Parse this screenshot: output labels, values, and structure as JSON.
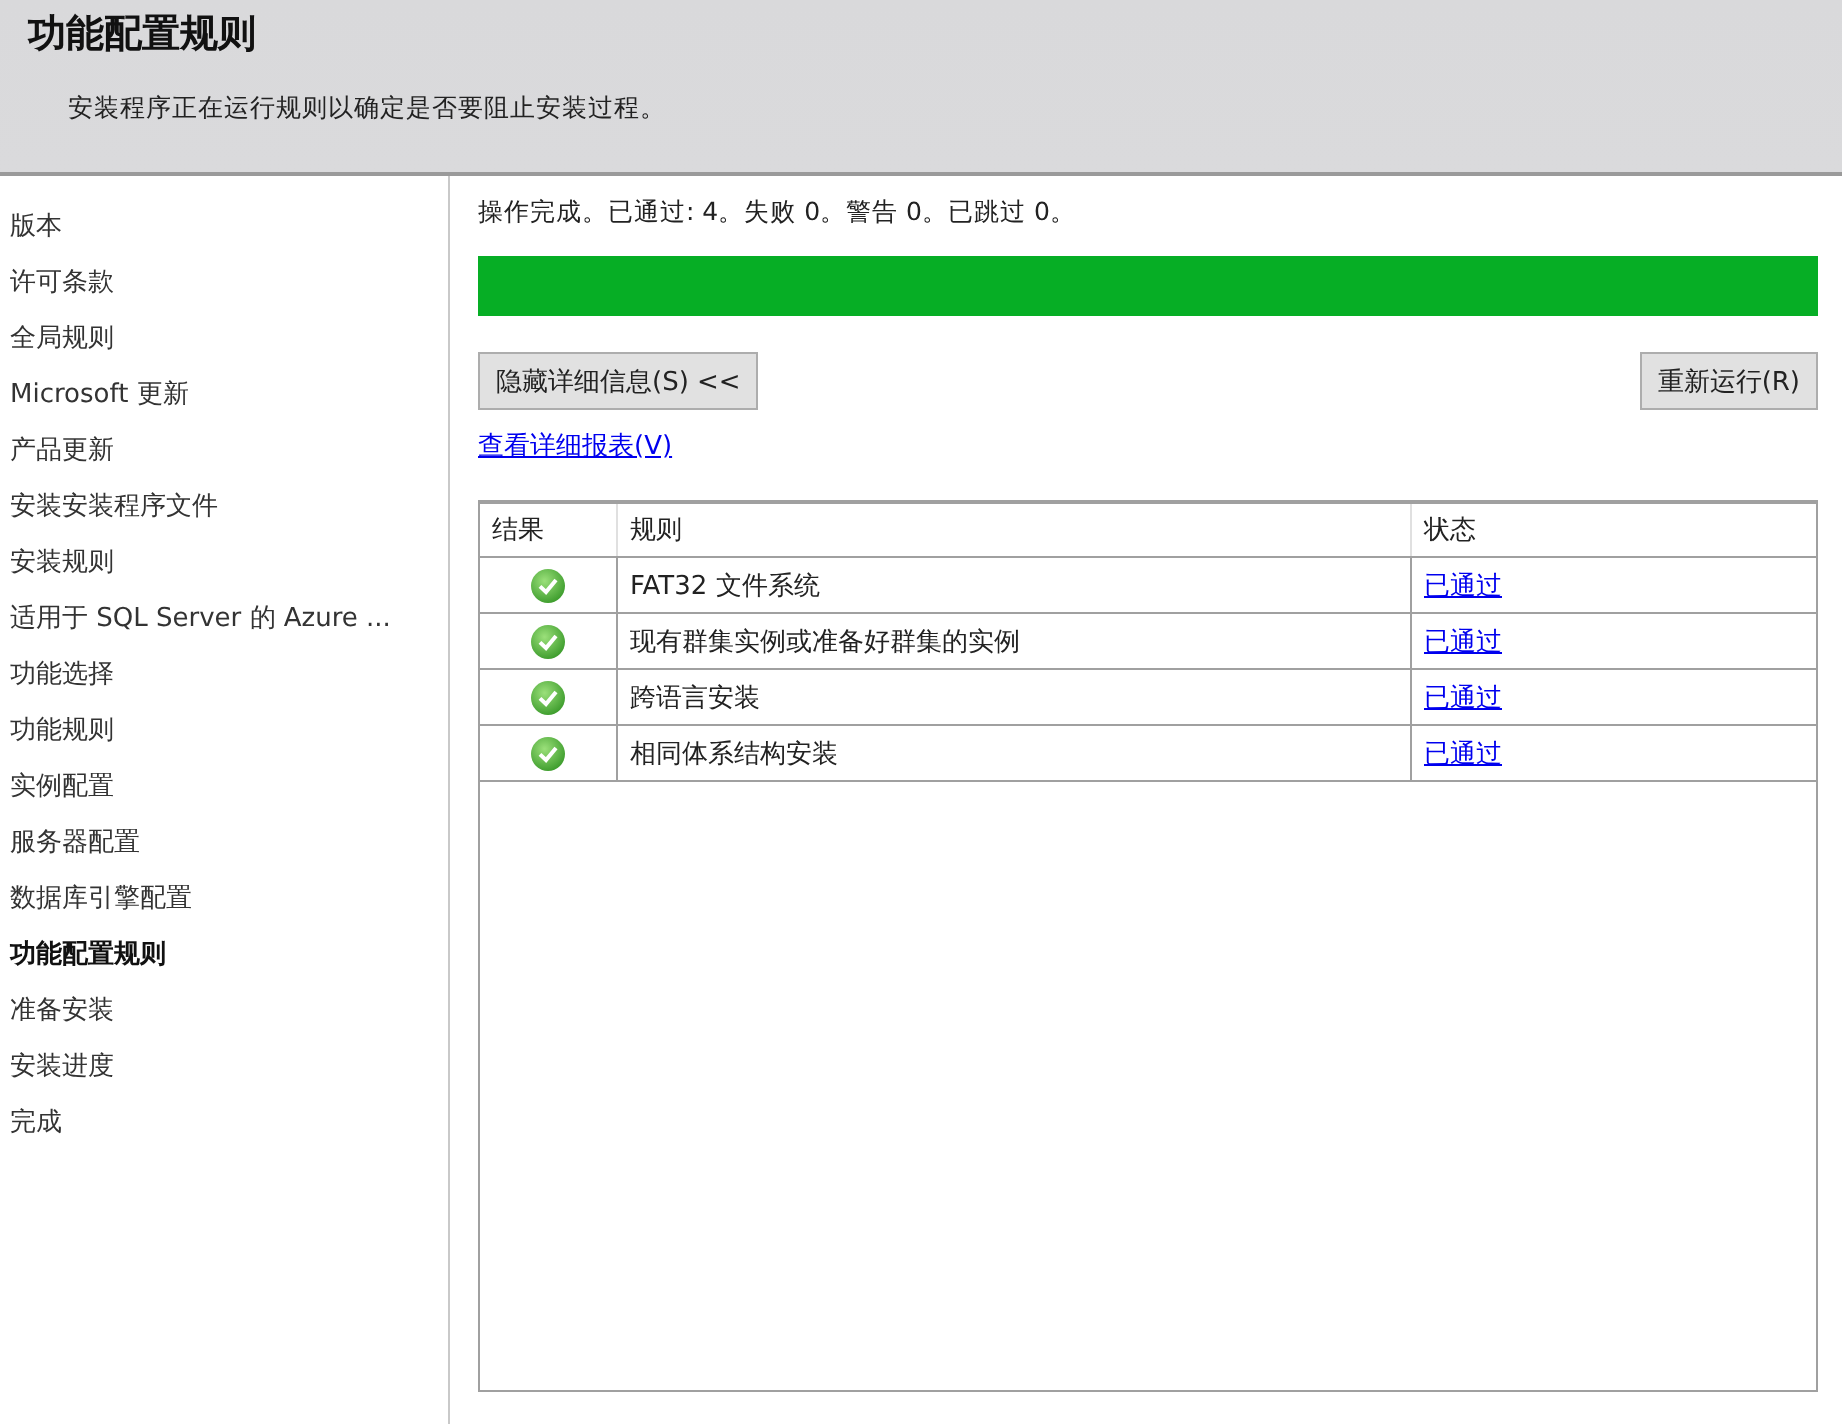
{
  "header": {
    "title": "功能配置规则",
    "subtitle": "安装程序正在运行规则以确定是否要阻止安装过程。"
  },
  "sidebar": {
    "items": [
      {
        "label": "版本",
        "selected": false
      },
      {
        "label": "许可条款",
        "selected": false
      },
      {
        "label": "全局规则",
        "selected": false
      },
      {
        "label": "Microsoft 更新",
        "selected": false
      },
      {
        "label": "产品更新",
        "selected": false
      },
      {
        "label": "安装安装程序文件",
        "selected": false
      },
      {
        "label": "安装规则",
        "selected": false
      },
      {
        "label": "适用于 SQL Server 的 Azure ...",
        "selected": false
      },
      {
        "label": "功能选择",
        "selected": false
      },
      {
        "label": "功能规则",
        "selected": false
      },
      {
        "label": "实例配置",
        "selected": false
      },
      {
        "label": "服务器配置",
        "selected": false
      },
      {
        "label": "数据库引擎配置",
        "selected": false
      },
      {
        "label": "功能配置规则",
        "selected": true
      },
      {
        "label": "准备安装",
        "selected": false
      },
      {
        "label": "安装进度",
        "selected": false
      },
      {
        "label": "完成",
        "selected": false
      }
    ]
  },
  "status_text": "操作完成。已通过: 4。失败 0。警告 0。已跳过 0。",
  "progress": {
    "level": 1
  },
  "hide_details_button": "隐藏详细信息(S) <<",
  "rerun_button": "重新运行(R)",
  "report_link": "查看详细报表(V)",
  "table": {
    "columns": [
      "结果",
      "规则",
      "状态"
    ],
    "rows": [
      {
        "kind": "pass",
        "rule": "FAT32 文件系统",
        "status": "已通过"
      },
      {
        "kind": "pass",
        "rule": "现有群集实例或准备好群集的实例",
        "status": "已通过"
      },
      {
        "kind": "pass",
        "rule": "跨语言安装",
        "status": "已通过"
      },
      {
        "kind": "pass",
        "rule": "相同体系结构安装",
        "status": "已通过"
      }
    ]
  }
}
